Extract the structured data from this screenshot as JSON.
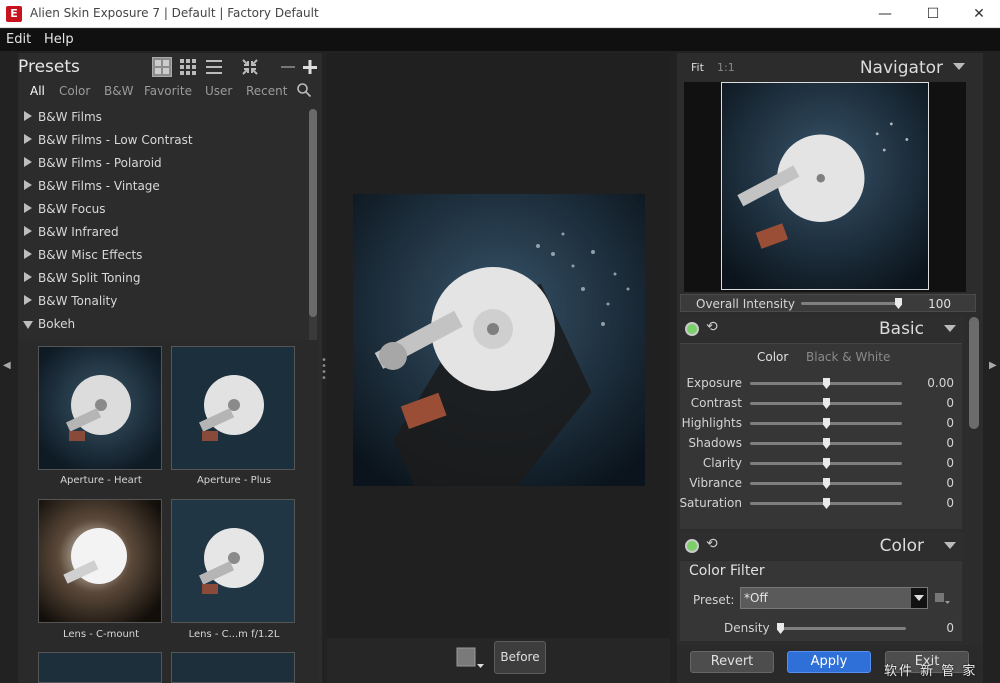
{
  "window": {
    "title": "Alien Skin Exposure 7 | Default | Factory Default",
    "icon_letter": "E",
    "minimize": "—",
    "maximize": "☐",
    "close": "✕"
  },
  "menu": [
    "Edit",
    "Help"
  ],
  "presets": {
    "title": "Presets",
    "tabs": [
      "All",
      "Color",
      "B&W",
      "Favorite",
      "User",
      "Recent"
    ],
    "active_tab": "All",
    "items": [
      {
        "label": "B&W Films",
        "open": false
      },
      {
        "label": "B&W Films - Low Contrast",
        "open": false
      },
      {
        "label": "B&W Films - Polaroid",
        "open": false
      },
      {
        "label": "B&W Films - Vintage",
        "open": false
      },
      {
        "label": "B&W Focus",
        "open": false
      },
      {
        "label": "B&W Infrared",
        "open": false
      },
      {
        "label": "B&W Misc Effects",
        "open": false
      },
      {
        "label": "B&W Split Toning",
        "open": false
      },
      {
        "label": "B&W Tonality",
        "open": false
      },
      {
        "label": "Bokeh",
        "open": true
      }
    ],
    "thumbnails": [
      {
        "label": "Aperture - Heart"
      },
      {
        "label": "Aperture - Plus"
      },
      {
        "label": "Lens - C-mount"
      },
      {
        "label": "Lens - C...m f/1.2L"
      }
    ]
  },
  "preview": {
    "before_label": "Before"
  },
  "navigator": {
    "fit": "Fit",
    "one_to_one": "1:1",
    "title": "Navigator",
    "overall_intensity_label": "Overall Intensity",
    "overall_intensity_value": "100",
    "overall_intensity_fraction": 0.98
  },
  "basic": {
    "title": "Basic",
    "mode_color": "Color",
    "mode_bw": "Black & White",
    "sliders": [
      {
        "label": "Exposure",
        "value": "0.00",
        "pos": 0.5
      },
      {
        "label": "Contrast",
        "value": "0",
        "pos": 0.5
      },
      {
        "label": "Highlights",
        "value": "0",
        "pos": 0.5
      },
      {
        "label": "Shadows",
        "value": "0",
        "pos": 0.5
      },
      {
        "label": "Clarity",
        "value": "0",
        "pos": 0.5
      },
      {
        "label": "Vibrance",
        "value": "0",
        "pos": 0.5
      },
      {
        "label": "Saturation",
        "value": "0",
        "pos": 0.5
      }
    ]
  },
  "color": {
    "title": "Color",
    "filter_title": "Color Filter",
    "preset_label": "Preset:",
    "preset_value": "*Off",
    "density_label": "Density",
    "density_value": "0"
  },
  "footer": {
    "revert": "Revert",
    "apply": "Apply",
    "exit": "Exit"
  },
  "watermark": "软件 新 管 家",
  "colors": {
    "accent_blue": "#2f6fd8",
    "active_green": "#7bd06a",
    "app_red": "#c8121e"
  }
}
